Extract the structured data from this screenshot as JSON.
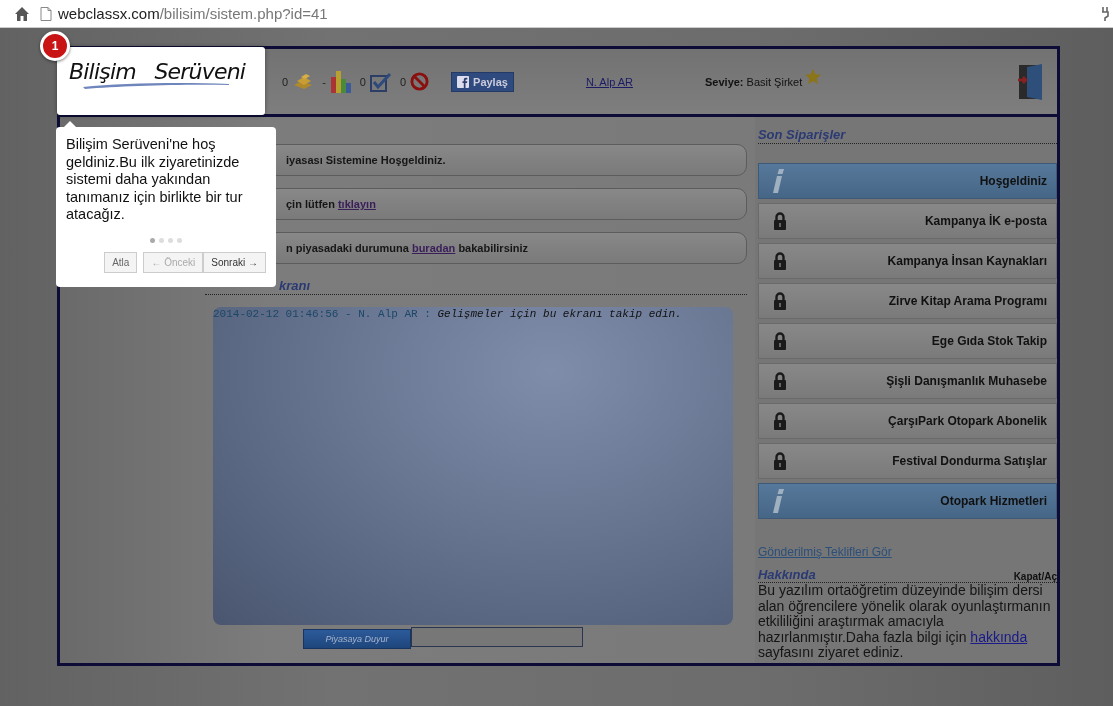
{
  "browser": {
    "url_host": "webclassx.com",
    "url_path": "/bilisim/sistem.php?id=41"
  },
  "header": {
    "logo": "Bilişim   Serüveni",
    "counters": [
      {
        "value": "0",
        "kind": "coins"
      },
      {
        "value": "-",
        "kind": "chart"
      },
      {
        "value": "0",
        "kind": "check"
      },
      {
        "value": "0",
        "kind": "ban"
      }
    ],
    "share_button": "Paylaş",
    "user_link": "N. Alp AR",
    "level_label": "Seviye:",
    "level_value": "Basit Şirket"
  },
  "messages": [
    [
      {
        "text": "iyasası Sistemine Hoşgeldiniz."
      }
    ],
    [
      {
        "text": "çin lütfen "
      },
      {
        "text": "tıklayın",
        "link": true
      }
    ],
    [
      {
        "text": "n piyasadaki durumuna "
      },
      {
        "text": "buradan",
        "link": true
      },
      {
        "text": " bakabilirsiniz"
      }
    ]
  ],
  "market": {
    "title": "kranı",
    "log": [
      {
        "meta": "2014-02-12 01:46:56 - N. Alp AR :",
        "message": "Gelişmeler için bu ekranı takip edin."
      }
    ],
    "announce_button": "Piyasaya Duyur"
  },
  "orders": {
    "title": "Son Siparişler",
    "items": [
      {
        "kind": "info",
        "label": "Hoşgeldiniz"
      },
      {
        "kind": "locked",
        "label": "Kampanya İK e-posta"
      },
      {
        "kind": "locked",
        "label": "Kampanya İnsan Kaynakları"
      },
      {
        "kind": "locked",
        "label": "Zirve Kitap Arama Programı"
      },
      {
        "kind": "locked",
        "label": "Ege Gıda Stok Takip"
      },
      {
        "kind": "locked",
        "label": "Şişli Danışmanlık Muhasebe"
      },
      {
        "kind": "locked",
        "label": "ÇarşıPark Otopark Abonelik"
      },
      {
        "kind": "locked",
        "label": "Festival Dondurma Satışlar"
      },
      {
        "kind": "info",
        "label": "Otopark Hizmetleri"
      }
    ],
    "sent_offers_link": "Gönderilmiş Teklifleri Gör"
  },
  "about": {
    "title": "Hakkında",
    "toggle": "Kapat/Aç",
    "text": [
      {
        "text": "Bu yazılım ortaöğretim düzeyinde bilişim dersi alan öğrencilere yönelik olarak oyunlaştırmanın etkililiğini araştırmak amacıyla hazırlanmıştır.Daha fazla bilgi için "
      },
      {
        "text": "hakkında",
        "link": true
      },
      {
        "text": " sayfasını ziyaret ediniz."
      }
    ]
  },
  "tour": {
    "step": "1",
    "text": "Bilişim Serüveni'ne hoş geldiniz.Bu ilk ziyaretinizde sistemi daha yakından tanımanız için birlikte bir tur atacağız.",
    "dots": [
      {
        "selected": true
      },
      {
        "selected": false
      },
      {
        "selected": false
      },
      {
        "selected": false
      }
    ],
    "buttons": [
      {
        "label": "Atla",
        "disabled": false
      },
      {
        "label": "← Önceki",
        "disabled": true
      },
      {
        "label": "Sonraki →",
        "disabled": false
      }
    ]
  }
}
